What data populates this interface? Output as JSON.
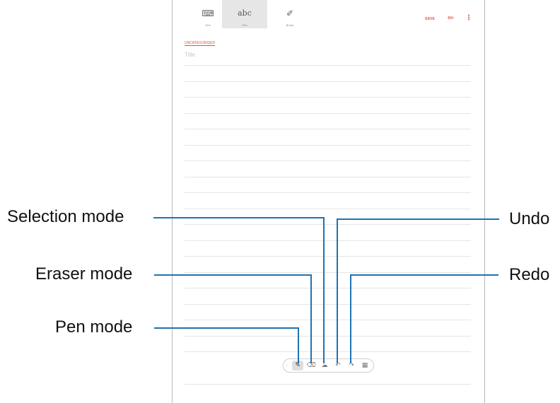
{
  "tabs": [
    {
      "label": "Text",
      "icon": "keyboard-icon"
    },
    {
      "label": "Pen",
      "icon": "abc-handwriting-icon",
      "icon_text": "abc",
      "active": true
    },
    {
      "label": "Brush",
      "icon": "brush-icon"
    }
  ],
  "header": {
    "save_label": "SAVE"
  },
  "note": {
    "category": "UNCATEGORISED",
    "title_placeholder": "Title"
  },
  "toolbar": {
    "active_tool": "pen"
  },
  "callouts": {
    "selection_mode": "Selection mode",
    "eraser_mode": "Eraser mode",
    "pen_mode": "Pen mode",
    "undo": "Undo",
    "redo": "Redo"
  },
  "colors": {
    "accent": "#e0533a",
    "leader": "#1e73b3"
  }
}
